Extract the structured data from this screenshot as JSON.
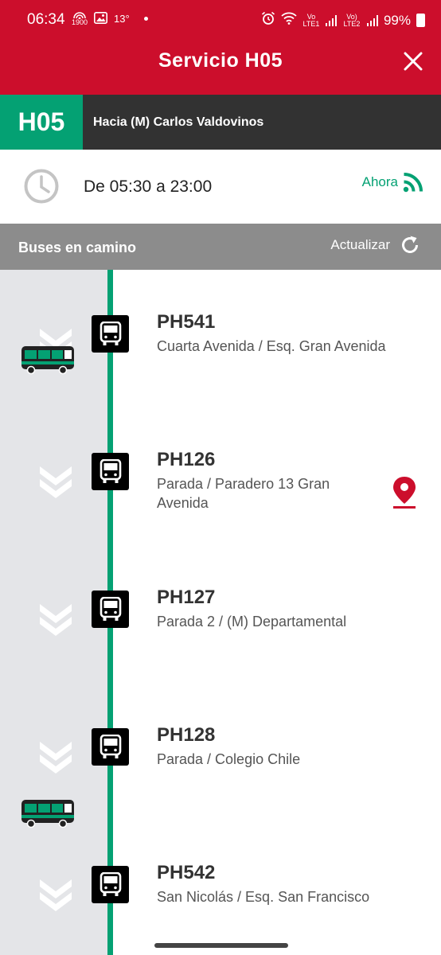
{
  "status_bar": {
    "time": "06:34",
    "temperature": "13°",
    "hotspot_label": "1900",
    "battery": "99%",
    "sim1_label": "Vo LTE1",
    "sim2_label": "Vo) LTE2"
  },
  "header": {
    "title": "Servicio H05",
    "close_icon": "close-icon"
  },
  "route": {
    "code": "H05",
    "destination": "Hacia (M) Carlos Valdovinos",
    "code_color": "#04a173"
  },
  "schedule": {
    "hours": "De 05:30 a 23:00",
    "now_label": "Ahora"
  },
  "section": {
    "title": "Buses en camino",
    "refresh_label": "Actualizar"
  },
  "stops": [
    {
      "code": "PH541",
      "name": "Cuarta Avenida / Esq. Gran Avenida"
    },
    {
      "code": "PH126",
      "name": "Parada / Paradero 13 Gran Avenida"
    },
    {
      "code": "PH127",
      "name": "Parada 2 / (M) Departamental"
    },
    {
      "code": "PH128",
      "name": "Parada / Colegio Chile"
    },
    {
      "code": "PH542",
      "name": "San Nicolás / Esq. San Francisco"
    }
  ],
  "colors": {
    "brand_red": "#cc0e2c",
    "route_green": "#04a173",
    "banner_dark": "#323232",
    "section_gray": "#8c8c8c",
    "lane_gray": "#e4e5e8"
  }
}
